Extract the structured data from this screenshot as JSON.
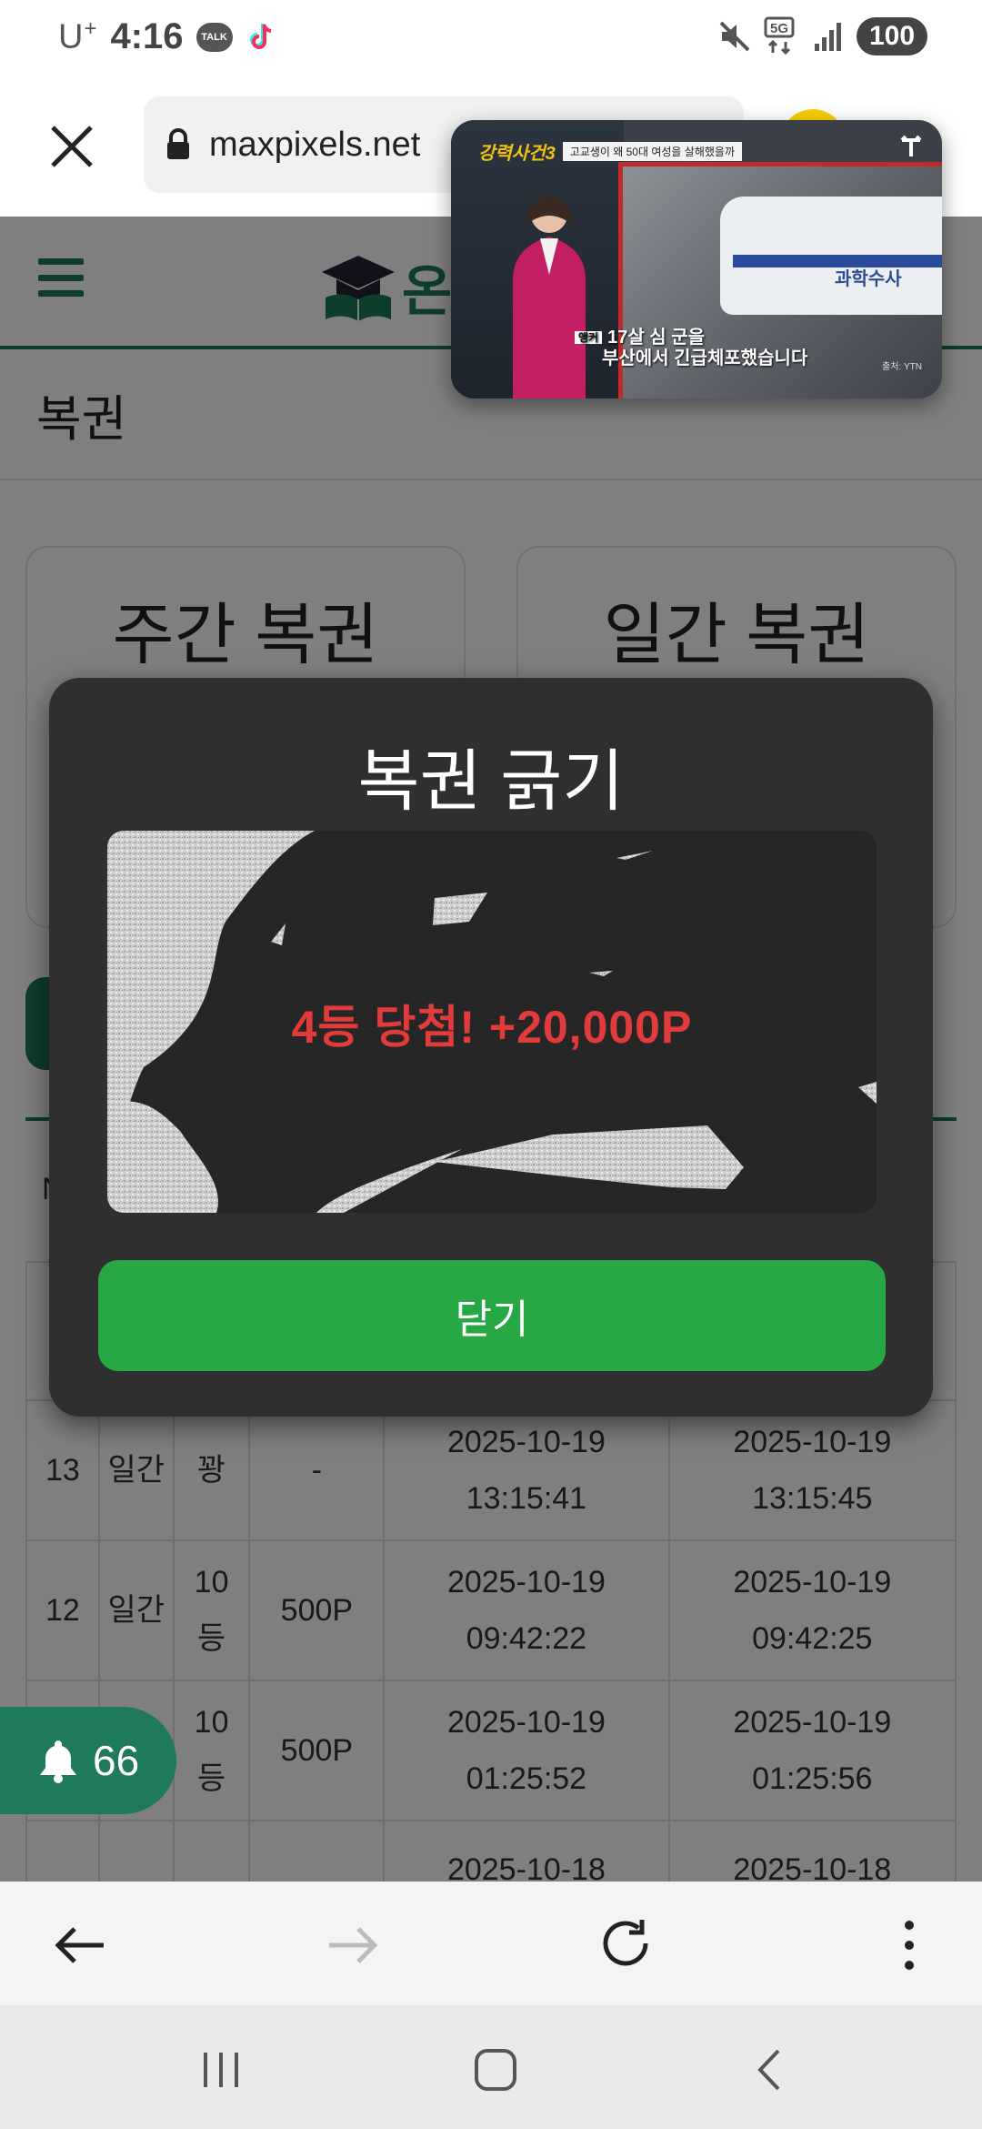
{
  "status_bar": {
    "carrier": "U",
    "carrier_plus": "+",
    "time": "4:16",
    "talk_icon": "TALK",
    "network": "5G",
    "battery": "100"
  },
  "browser": {
    "url": "maxpixels.net",
    "close_icon": "close-icon",
    "lock_icon": "lock-icon"
  },
  "site": {
    "logo_text": "온",
    "page_title": "복권",
    "cards": [
      "주간 복권",
      "일간 복권"
    ],
    "n_label": "N"
  },
  "table": {
    "rows": [
      {
        "no": "13",
        "type": "일간",
        "grade": "꽝",
        "points": "-",
        "start_date": "2025-10-19",
        "start_time": "13:15:41",
        "end_date": "2025-10-19",
        "end_time": "13:15:45"
      },
      {
        "no": "12",
        "type": "일간",
        "grade": "10\n등",
        "points": "500P",
        "start_date": "2025-10-19",
        "start_time": "09:42:22",
        "end_date": "2025-10-19",
        "end_time": "09:42:25"
      },
      {
        "no": "",
        "type": "",
        "grade": "10\n등",
        "points": "500P",
        "start_date": "2025-10-19",
        "start_time": "01:25:52",
        "end_date": "2025-10-19",
        "end_time": "01:25:56"
      },
      {
        "no": "",
        "type": "",
        "grade": "",
        "points": "",
        "start_date": "2025-10-18",
        "start_time": "",
        "end_date": "2025-10-18",
        "end_time": ""
      }
    ]
  },
  "notification": {
    "count": "66"
  },
  "modal": {
    "title": "복권 긁기",
    "result": "4등 당첨! +20,000P",
    "close_label": "닫기"
  },
  "video": {
    "banner_logo": "강력사건3",
    "banner_strip": "고교생이 왜 50대 여성을 살해했을까",
    "caption_tag": "앵커",
    "caption_line1": "17살 심 군을",
    "caption_line2": "부산에서 긴급체포했습니다",
    "van_text": "과학수사",
    "source": "출처: YTN"
  },
  "colors": {
    "brand_green": "#1f7a5a",
    "button_green": "#28a745",
    "result_red": "#e23b3b",
    "modal_bg": "#2f2f2f"
  }
}
